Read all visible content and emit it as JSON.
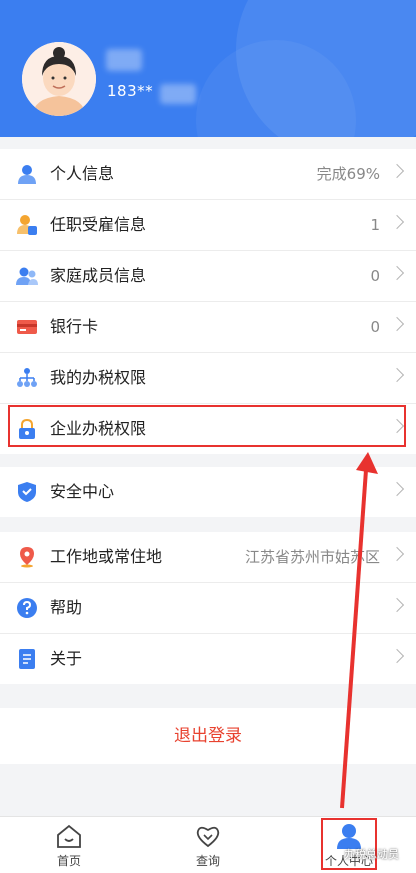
{
  "profile": {
    "phone": "183**"
  },
  "menu_group1": [
    {
      "label": "个人信息",
      "value": "完成69%",
      "icon": "person-icon"
    },
    {
      "label": "任职受雇信息",
      "value": "1",
      "icon": "employment-icon"
    },
    {
      "label": "家庭成员信息",
      "value": "0",
      "icon": "family-icon"
    },
    {
      "label": "银行卡",
      "value": "0",
      "icon": "bank-card-icon"
    },
    {
      "label": "我的办税权限",
      "value": "",
      "icon": "org-chart-icon"
    },
    {
      "label": "企业办税权限",
      "value": "",
      "icon": "lock-icon"
    }
  ],
  "menu_group2": [
    {
      "label": "安全中心",
      "value": "",
      "icon": "shield-icon"
    }
  ],
  "menu_group3": [
    {
      "label": "工作地或常住地",
      "value": "江苏省苏州市姑苏区",
      "icon": "location-icon"
    },
    {
      "label": "帮助",
      "value": "",
      "icon": "help-icon"
    },
    {
      "label": "关于",
      "value": "",
      "icon": "document-icon"
    }
  ],
  "logout_label": "退出登录",
  "tabs": [
    {
      "label": "首页",
      "icon": "home-icon"
    },
    {
      "label": "查询",
      "icon": "heart-icon"
    },
    {
      "label": "个人中心",
      "icon": "user-icon"
    }
  ],
  "watermark": "办税总动员",
  "colors": {
    "header_blue": "#3b7ef0",
    "highlight_red": "#e8322f",
    "logout_red": "#e8422f"
  }
}
